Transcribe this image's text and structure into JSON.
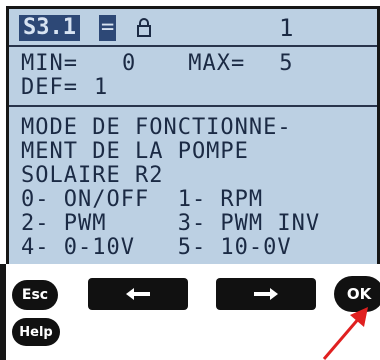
{
  "header": {
    "parameter_id": "S3.1",
    "equals": "=",
    "value": "1",
    "lock_icon": "lock-icon"
  },
  "limits": {
    "min_label": "MIN=",
    "min_value": "0",
    "max_label": "MAX=",
    "max_value": "5",
    "def_label": "DEF=",
    "def_value": "1"
  },
  "description": {
    "lines": [
      "MODE DE FONCTIONNE-",
      "MENT DE LA POMPE",
      "SOLAIRE R2",
      "0- ON/OFF  1- RPM",
      "2- PWM     3- PWM INV",
      "4- 0-10V   5- 10-0V"
    ]
  },
  "softkeys": {
    "esc": "Esc",
    "left_icon": "arrow-left-icon",
    "right_icon": "arrow-right-icon",
    "ok": "OK",
    "help": "Help"
  },
  "colors": {
    "lcd_bg": "#bcd0e3",
    "lcd_text": "#1b2a44",
    "highlight": "#2d4876",
    "pointer": "#e02020"
  }
}
